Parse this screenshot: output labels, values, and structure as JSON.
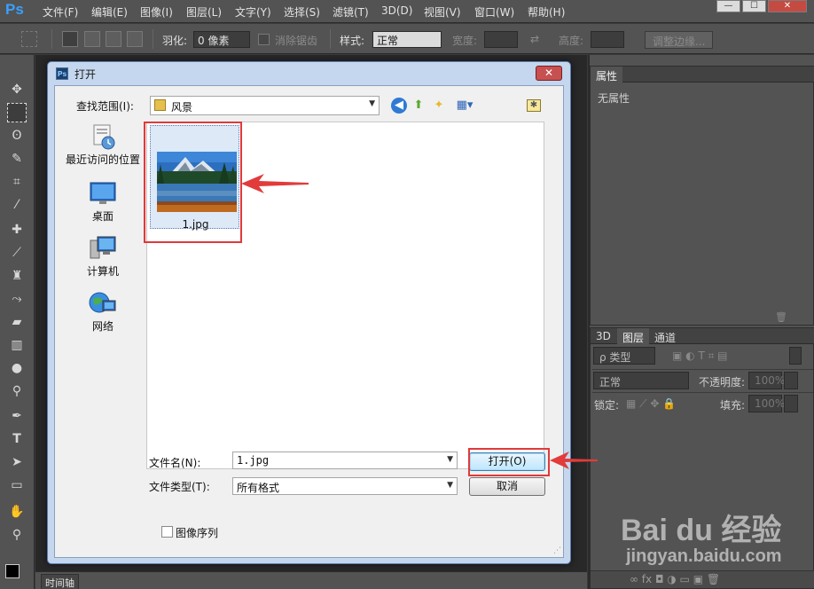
{
  "app": {
    "logo": "Ps",
    "menu": [
      "文件(F)",
      "编辑(E)",
      "图像(I)",
      "图层(L)",
      "文字(Y)",
      "选择(S)",
      "滤镜(T)",
      "3D(D)",
      "视图(V)",
      "窗口(W)",
      "帮助(H)"
    ],
    "window_buttons": [
      "—",
      "☐",
      "✕"
    ]
  },
  "options": {
    "feather_label": "羽化:",
    "feather_value": "0 像素",
    "antialias_label": "消除锯齿",
    "style_label": "样式:",
    "style_value": "正常",
    "width_label": "宽度:",
    "height_label": "高度:",
    "refine_button": "调整边缘..."
  },
  "panels": {
    "properties_tab": "属性",
    "no_properties": "无属性",
    "tabs": [
      "3D",
      "图层",
      "通道"
    ],
    "kind_label": "ρ 类型",
    "blend_mode": "正常",
    "opacity_label": "不透明度:",
    "opacity_value": "100%",
    "lock_label": "锁定:",
    "fill_label": "填充:",
    "fill_value": "100%"
  },
  "timeline": {
    "tab": "时间轴"
  },
  "dialog": {
    "title": "打开",
    "close": "✕",
    "look_in_label": "查找范围(I):",
    "look_in_value": "风景",
    "places": [
      {
        "label": "最近访问的位置",
        "icon": "recent-places-icon"
      },
      {
        "label": "桌面",
        "icon": "desktop-icon"
      },
      {
        "label": "计算机",
        "icon": "computer-icon"
      },
      {
        "label": "网络",
        "icon": "network-icon"
      }
    ],
    "file": {
      "name": "1.jpg"
    },
    "filename_label": "文件名(N):",
    "filename_value": "1.jpg",
    "filetype_label": "文件类型(T):",
    "filetype_value": "所有格式",
    "open_button": "打开(O)",
    "cancel_button": "取消",
    "image_sequence": "图像序列"
  },
  "watermark": {
    "logo": "Bai du 经验",
    "url": "jingyan.baidu.com"
  },
  "colors": {
    "annotation": "#e03a3a",
    "ps_blue": "#3aa0ff",
    "dialog_frame": "#c4d7ee"
  }
}
